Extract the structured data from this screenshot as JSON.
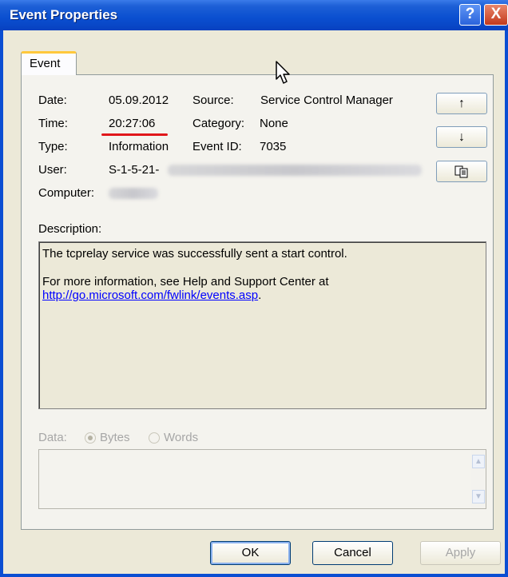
{
  "window": {
    "title": "Event Properties"
  },
  "tabs": [
    {
      "label": "Event"
    }
  ],
  "fields": {
    "date": {
      "label": "Date:",
      "value": "05.09.2012"
    },
    "time": {
      "label": "Time:",
      "value": "20:27:06"
    },
    "type": {
      "label": "Type:",
      "value": "Information"
    },
    "user": {
      "label": "User:",
      "value": "S-1-5-21-"
    },
    "computer": {
      "label": "Computer:",
      "value": ""
    },
    "source": {
      "label": "Source:",
      "value": "Service Control Manager"
    },
    "category": {
      "label": "Category:",
      "value": "None"
    },
    "event_id": {
      "label": "Event ID:",
      "value": "7035"
    }
  },
  "description": {
    "label": "Description:",
    "line1": "The tcprelay service was successfully sent a start control.",
    "line2": "For more information, see Help and Support Center at",
    "link": "http://go.microsoft.com/fwlink/events.asp",
    "link_suffix": "."
  },
  "data_section": {
    "label": "Data:",
    "options": [
      "Bytes",
      "Words"
    ],
    "selected": "Bytes"
  },
  "buttons": {
    "ok": "OK",
    "cancel": "Cancel",
    "apply": "Apply"
  },
  "icons": {
    "help": "?",
    "close": "X",
    "up": "↑",
    "down": "↓",
    "copy": "copy-icon"
  }
}
